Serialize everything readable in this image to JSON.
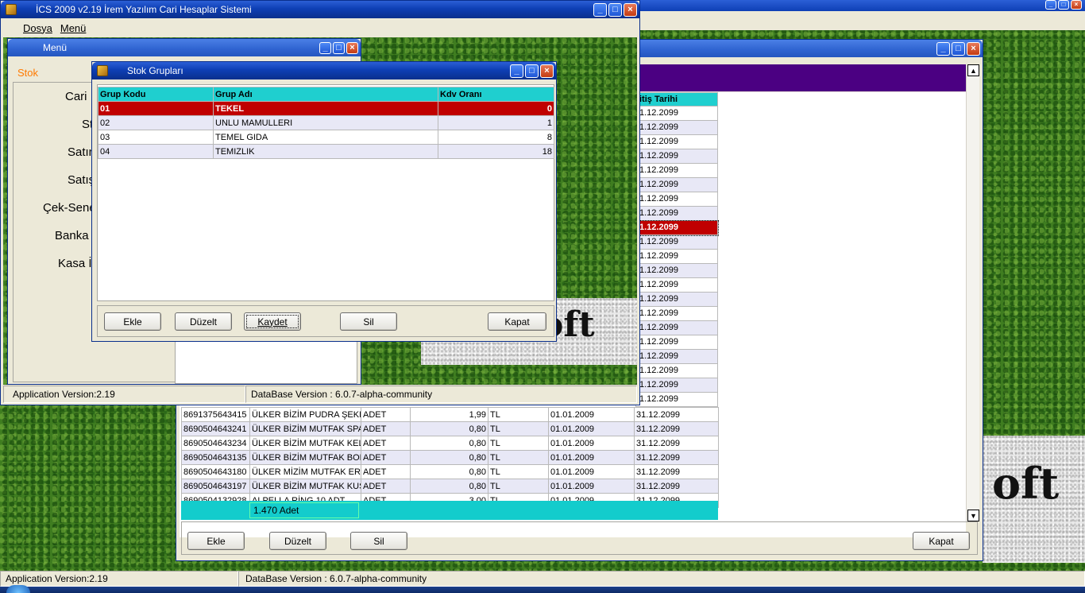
{
  "main_window": {
    "title": "İCS 2009 v2.19 İrem Yazılım Cari Hesaplar Sistemi",
    "menu": [
      "Dosya",
      "Menü"
    ],
    "status": {
      "app_version": "Application Version:2.19",
      "db_version": "DataBase Version : 6.0.7-alpha-community"
    }
  },
  "desktop_status": {
    "app_version": "Application Version:2.19",
    "db_version": "DataBase Version : 6.0.7-alpha-community"
  },
  "menu_window": {
    "title": "Menü",
    "tab": "Stok",
    "items": [
      "Cari İ",
      "St",
      "Satın",
      "Satış",
      "Çek-Sene",
      "Banka İ",
      "Kasa İş"
    ]
  },
  "stok_gruplari": {
    "title": "Stok Grupları",
    "columns": [
      "Grup Kodu",
      "Grup Adı",
      "Kdv Oranı"
    ],
    "rows": [
      {
        "kod": "01",
        "ad": "TEKEL",
        "kdv": "0"
      },
      {
        "kod": "02",
        "ad": "UNLU MAMULLERI",
        "kdv": "1"
      },
      {
        "kod": "03",
        "ad": "TEMEL GIDA",
        "kdv": "8"
      },
      {
        "kod": "04",
        "ad": "TEMIZLIK",
        "kdv": "18"
      }
    ],
    "buttons": {
      "ekle": "Ekle",
      "duzelt": "Düzelt",
      "kaydet": "Kaydet",
      "sil": "Sil",
      "kapat": "Kapat"
    }
  },
  "stok_list": {
    "date_header": "itiş Tarihi",
    "upper_dates": [
      "1.12.2099",
      "1.12.2099",
      "1.12.2099",
      "1.12.2099",
      "1.12.2099",
      "1.12.2099",
      "1.12.2099",
      "1.12.2099",
      "1.12.2099",
      "1.12.2099",
      "1.12.2099",
      "1.12.2099",
      "1.12.2099",
      "1.12.2099",
      "1.12.2099",
      "1.12.2099",
      "1.12.2099",
      "1.12.2099",
      "1.12.2099",
      "1.12.2099",
      "1.12.2099"
    ],
    "rows": [
      {
        "barkod": "8691375643415",
        "ad": "ÜLKER BİZİM PUDRA ŞEKER",
        "birim": "ADET",
        "fiyat": "1,99",
        "para": "TL",
        "bas": "01.01.2009",
        "bit": "31.12.2099"
      },
      {
        "barkod": "8690504643241",
        "ad": "ÜLKER BİZİM MUTFAK  SPA",
        "birim": "ADET",
        "fiyat": "0,80",
        "para": "TL",
        "bas": "01.01.2009",
        "bit": "31.12.2099"
      },
      {
        "barkod": "8690504643234",
        "ad": "ÜLKER BİZİM MUTFAK KELE",
        "birim": "ADET",
        "fiyat": "0,80",
        "para": "TL",
        "bas": "01.01.2009",
        "bit": "31.12.2099"
      },
      {
        "barkod": "8690504643135",
        "ad": "ÜLKER BİZİM MUTFAK BON",
        "birim": "ADET",
        "fiyat": "0,80",
        "para": "TL",
        "bas": "01.01.2009",
        "bit": "31.12.2099"
      },
      {
        "barkod": "8690504643180",
        "ad": "ÜLKER MİZİM MUTFAK ERİŞ",
        "birim": "ADET",
        "fiyat": "0,80",
        "para": "TL",
        "bas": "01.01.2009",
        "bit": "31.12.2099"
      },
      {
        "barkod": "8690504643197",
        "ad": "ÜLKER BİZİM MUTFAK KUSI",
        "birim": "ADET",
        "fiyat": "0,80",
        "para": "TL",
        "bas": "01.01.2009",
        "bit": "31.12.2099"
      },
      {
        "barkod": "8690504132928",
        "ad": "ALPELLA RİNG 10 ADT",
        "birim": "ADET",
        "fiyat": "3,00",
        "para": "TL",
        "bas": "01.01.2009",
        "bit": "31.12.2099"
      }
    ],
    "total": "1.470 Adet",
    "buttons": {
      "ekle": "Ekle",
      "duzelt": "Düzelt",
      "sil": "Sil",
      "kapat": "Kapat"
    }
  },
  "logo_fragment": "oft",
  "colors": {
    "selected_row": "#c00000",
    "header": "#1fcfcf",
    "purple_band": "#4b0082"
  }
}
